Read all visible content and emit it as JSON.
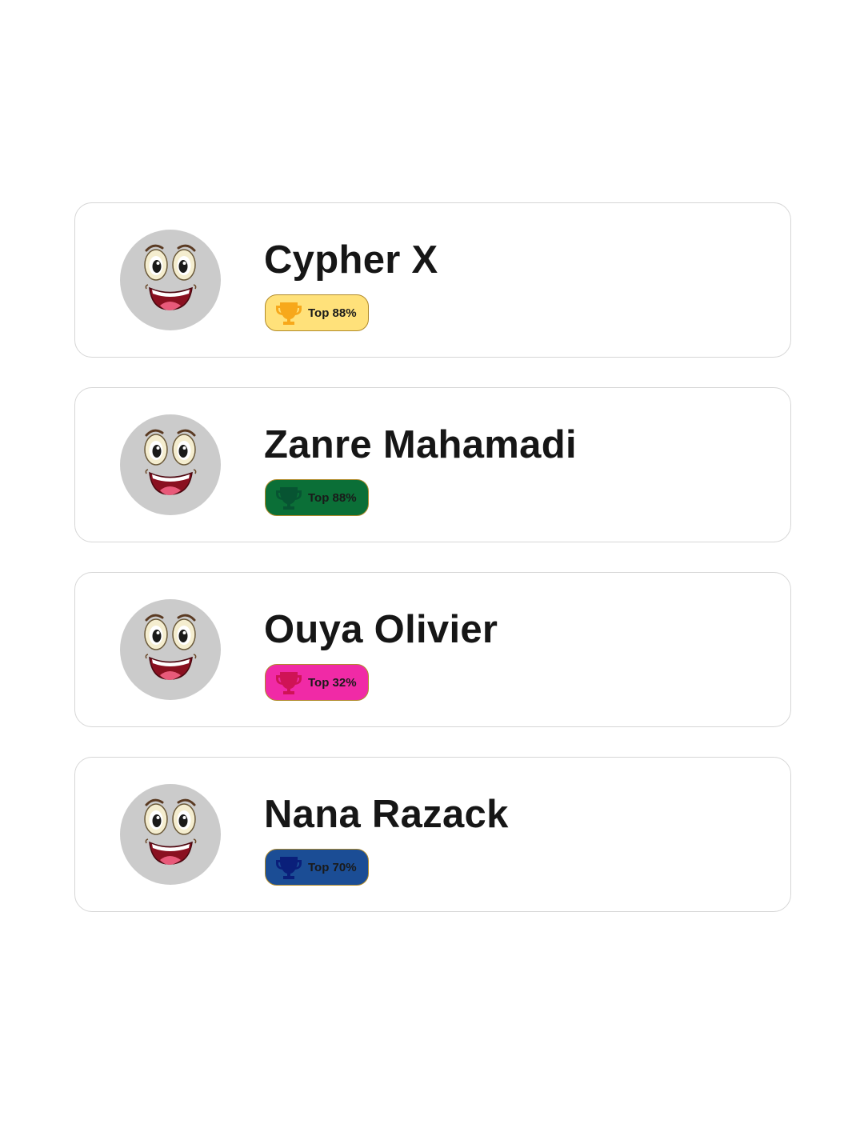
{
  "leaderboard": {
    "entries": [
      {
        "name": "Cypher X",
        "badge_label": "Top 88%",
        "badge_bg": "#ffe17a",
        "trophy_color": "#f7a81b"
      },
      {
        "name": "Zanre Mahamadi",
        "badge_label": "Top 88%",
        "badge_bg": "#0b6f37",
        "trophy_color": "#075432"
      },
      {
        "name": "Ouya Olivier",
        "badge_label": "Top 32%",
        "badge_bg": "#f02aa6",
        "trophy_color": "#cf1356"
      },
      {
        "name": "Nana Razack",
        "badge_label": "Top 70%",
        "badge_bg": "#1b4d95",
        "trophy_color": "#0a1f7a"
      }
    ]
  },
  "icons": {
    "avatar": "smiley-face-icon",
    "badge": "trophy-icon"
  }
}
